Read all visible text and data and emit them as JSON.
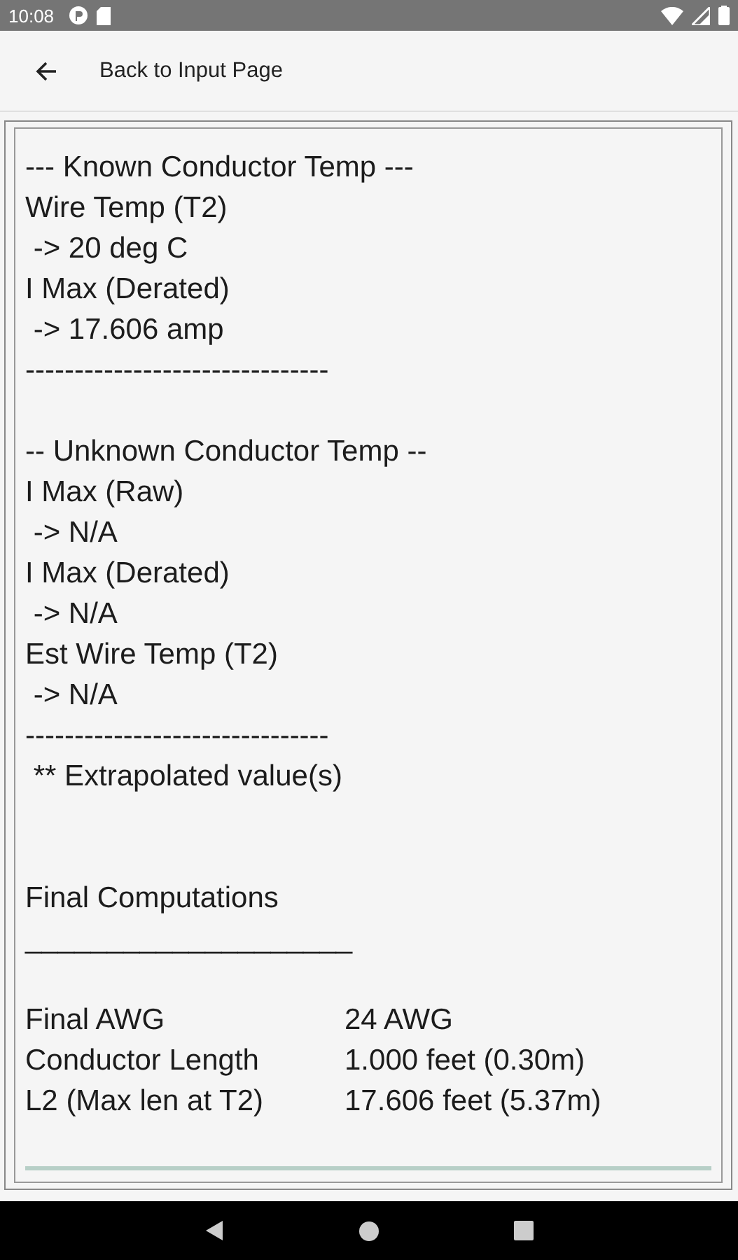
{
  "status_bar": {
    "time": "10:08"
  },
  "app_bar": {
    "title": "Back to Input Page"
  },
  "report": [
    {
      "kind": "text",
      "text": "--- Known Conductor Temp ---"
    },
    {
      "kind": "text",
      "text": "Wire Temp (T2)"
    },
    {
      "kind": "text",
      "text": " -> 20 deg C"
    },
    {
      "kind": "text",
      "text": "I Max (Derated)"
    },
    {
      "kind": "text",
      "text": " -> 17.606 amp"
    },
    {
      "kind": "text",
      "text": "-------------------------------"
    },
    {
      "kind": "blank"
    },
    {
      "kind": "text",
      "text": "-- Unknown Conductor Temp --"
    },
    {
      "kind": "text",
      "text": "I Max (Raw)"
    },
    {
      "kind": "text",
      "text": " -> N/A"
    },
    {
      "kind": "text",
      "text": "I Max (Derated)"
    },
    {
      "kind": "text",
      "text": " -> N/A"
    },
    {
      "kind": "text",
      "text": "Est Wire Temp (T2)"
    },
    {
      "kind": "text",
      "text": " -> N/A"
    },
    {
      "kind": "text",
      "text": "-------------------------------"
    },
    {
      "kind": "text",
      "text": " ** Extrapolated value(s)"
    },
    {
      "kind": "blank"
    },
    {
      "kind": "blank"
    },
    {
      "kind": "text",
      "text": "Final Computations"
    },
    {
      "kind": "text",
      "text": "____________________"
    },
    {
      "kind": "blank"
    },
    {
      "kind": "row",
      "label": "Final AWG",
      "value": "24 AWG"
    },
    {
      "kind": "row",
      "label": "Conductor Length",
      "value": "1.000 feet (0.30m)"
    },
    {
      "kind": "row",
      "label": "L2 (Max len at T2)",
      "value": "17.606 feet (5.37m)"
    }
  ]
}
